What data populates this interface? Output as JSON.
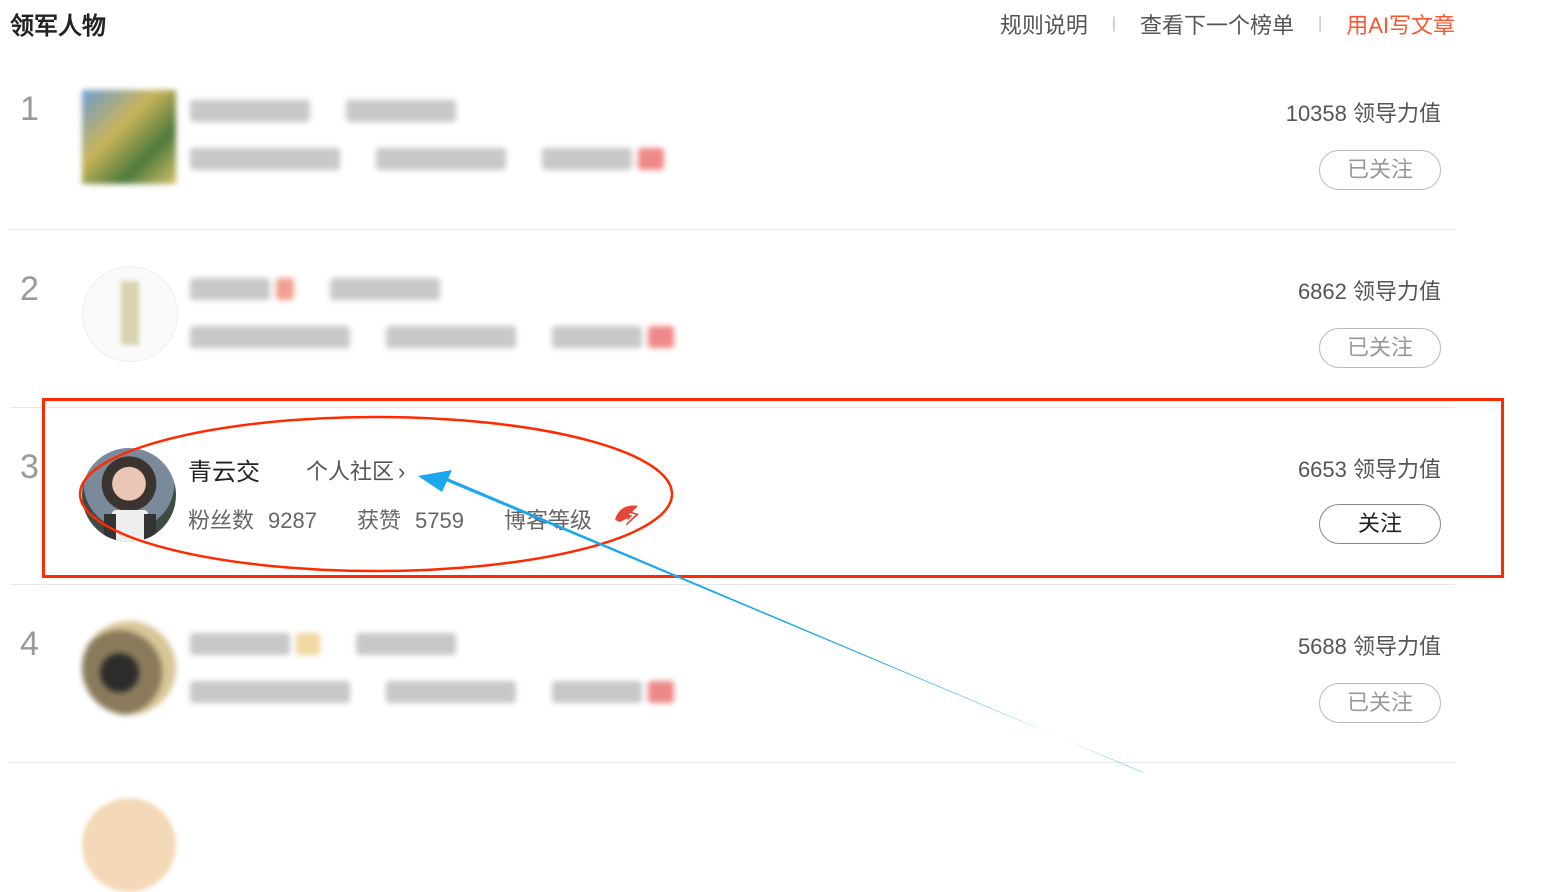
{
  "header": {
    "title": "领军人物",
    "links": {
      "rules": "规则说明",
      "next_list": "查看下一个榜单",
      "ai_write": "用AI写文章"
    },
    "separator": "|"
  },
  "rows": [
    {
      "rank": "1",
      "score": "10358 领导力值",
      "follow_label": "已关注",
      "blurred": true
    },
    {
      "rank": "2",
      "score": "6862 领导力值",
      "follow_label": "已关注",
      "blurred": true
    },
    {
      "rank": "3",
      "name": "青云交",
      "community_link": "个人社区",
      "fans_label": "粉丝数",
      "fans_value": "9287",
      "likes_label": "获赞",
      "likes_value": "5759",
      "level_label": "博客等级",
      "score": "6653 领导力值",
      "follow_label": "关注",
      "blurred": false
    },
    {
      "rank": "4",
      "score": "5688 领导力值",
      "follow_label": "已关注",
      "blurred": true
    }
  ],
  "colors": {
    "accent": "#fc5531",
    "highlight_box": "#ff2a00",
    "arrow": "#1aa7ee"
  }
}
